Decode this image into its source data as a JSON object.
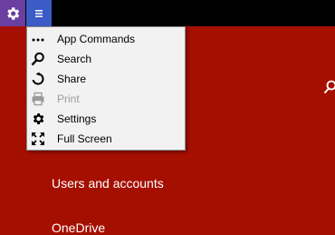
{
  "menu": {
    "items": [
      {
        "label": "App Commands",
        "icon": "ellipsis-icon",
        "enabled": true
      },
      {
        "label": "Search",
        "icon": "search-icon",
        "enabled": true
      },
      {
        "label": "Share",
        "icon": "share-icon",
        "enabled": true
      },
      {
        "label": "Print",
        "icon": "print-icon",
        "enabled": false
      },
      {
        "label": "Settings",
        "icon": "gear-icon",
        "enabled": true
      },
      {
        "label": "Full Screen",
        "icon": "fullscreen-icon",
        "enabled": true
      }
    ]
  },
  "background": {
    "items": [
      "Users and accounts",
      "OneDrive"
    ]
  },
  "colors": {
    "accent_red": "#a50f00",
    "gear_tile": "#6a3fa0",
    "menu_tile": "#3a5cc4"
  }
}
